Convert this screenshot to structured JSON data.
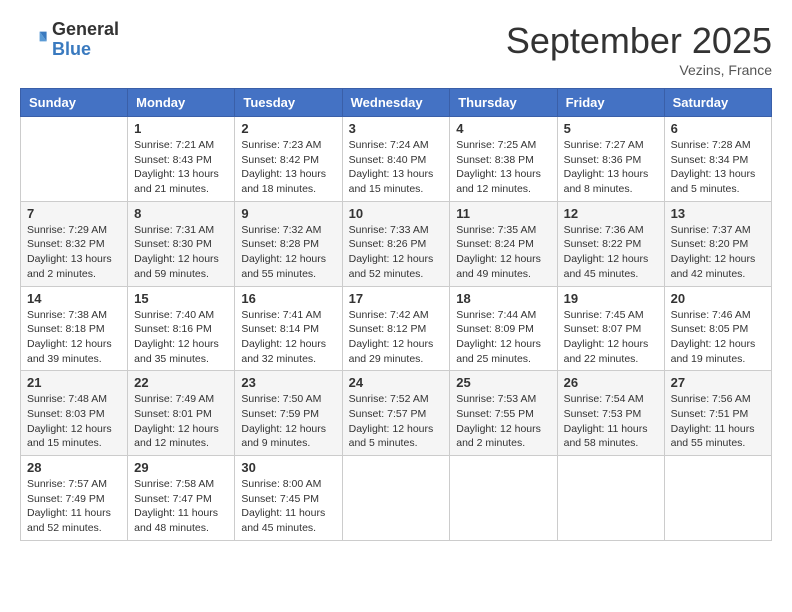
{
  "logo": {
    "general": "General",
    "blue": "Blue"
  },
  "header": {
    "month": "September 2025",
    "location": "Vezins, France"
  },
  "weekdays": [
    "Sunday",
    "Monday",
    "Tuesday",
    "Wednesday",
    "Thursday",
    "Friday",
    "Saturday"
  ],
  "weeks": [
    [
      {
        "day": "",
        "info": ""
      },
      {
        "day": "1",
        "info": "Sunrise: 7:21 AM\nSunset: 8:43 PM\nDaylight: 13 hours\nand 21 minutes."
      },
      {
        "day": "2",
        "info": "Sunrise: 7:23 AM\nSunset: 8:42 PM\nDaylight: 13 hours\nand 18 minutes."
      },
      {
        "day": "3",
        "info": "Sunrise: 7:24 AM\nSunset: 8:40 PM\nDaylight: 13 hours\nand 15 minutes."
      },
      {
        "day": "4",
        "info": "Sunrise: 7:25 AM\nSunset: 8:38 PM\nDaylight: 13 hours\nand 12 minutes."
      },
      {
        "day": "5",
        "info": "Sunrise: 7:27 AM\nSunset: 8:36 PM\nDaylight: 13 hours\nand 8 minutes."
      },
      {
        "day": "6",
        "info": "Sunrise: 7:28 AM\nSunset: 8:34 PM\nDaylight: 13 hours\nand 5 minutes."
      }
    ],
    [
      {
        "day": "7",
        "info": "Sunrise: 7:29 AM\nSunset: 8:32 PM\nDaylight: 13 hours\nand 2 minutes."
      },
      {
        "day": "8",
        "info": "Sunrise: 7:31 AM\nSunset: 8:30 PM\nDaylight: 12 hours\nand 59 minutes."
      },
      {
        "day": "9",
        "info": "Sunrise: 7:32 AM\nSunset: 8:28 PM\nDaylight: 12 hours\nand 55 minutes."
      },
      {
        "day": "10",
        "info": "Sunrise: 7:33 AM\nSunset: 8:26 PM\nDaylight: 12 hours\nand 52 minutes."
      },
      {
        "day": "11",
        "info": "Sunrise: 7:35 AM\nSunset: 8:24 PM\nDaylight: 12 hours\nand 49 minutes."
      },
      {
        "day": "12",
        "info": "Sunrise: 7:36 AM\nSunset: 8:22 PM\nDaylight: 12 hours\nand 45 minutes."
      },
      {
        "day": "13",
        "info": "Sunrise: 7:37 AM\nSunset: 8:20 PM\nDaylight: 12 hours\nand 42 minutes."
      }
    ],
    [
      {
        "day": "14",
        "info": "Sunrise: 7:38 AM\nSunset: 8:18 PM\nDaylight: 12 hours\nand 39 minutes."
      },
      {
        "day": "15",
        "info": "Sunrise: 7:40 AM\nSunset: 8:16 PM\nDaylight: 12 hours\nand 35 minutes."
      },
      {
        "day": "16",
        "info": "Sunrise: 7:41 AM\nSunset: 8:14 PM\nDaylight: 12 hours\nand 32 minutes."
      },
      {
        "day": "17",
        "info": "Sunrise: 7:42 AM\nSunset: 8:12 PM\nDaylight: 12 hours\nand 29 minutes."
      },
      {
        "day": "18",
        "info": "Sunrise: 7:44 AM\nSunset: 8:09 PM\nDaylight: 12 hours\nand 25 minutes."
      },
      {
        "day": "19",
        "info": "Sunrise: 7:45 AM\nSunset: 8:07 PM\nDaylight: 12 hours\nand 22 minutes."
      },
      {
        "day": "20",
        "info": "Sunrise: 7:46 AM\nSunset: 8:05 PM\nDaylight: 12 hours\nand 19 minutes."
      }
    ],
    [
      {
        "day": "21",
        "info": "Sunrise: 7:48 AM\nSunset: 8:03 PM\nDaylight: 12 hours\nand 15 minutes."
      },
      {
        "day": "22",
        "info": "Sunrise: 7:49 AM\nSunset: 8:01 PM\nDaylight: 12 hours\nand 12 minutes."
      },
      {
        "day": "23",
        "info": "Sunrise: 7:50 AM\nSunset: 7:59 PM\nDaylight: 12 hours\nand 9 minutes."
      },
      {
        "day": "24",
        "info": "Sunrise: 7:52 AM\nSunset: 7:57 PM\nDaylight: 12 hours\nand 5 minutes."
      },
      {
        "day": "25",
        "info": "Sunrise: 7:53 AM\nSunset: 7:55 PM\nDaylight: 12 hours\nand 2 minutes."
      },
      {
        "day": "26",
        "info": "Sunrise: 7:54 AM\nSunset: 7:53 PM\nDaylight: 11 hours\nand 58 minutes."
      },
      {
        "day": "27",
        "info": "Sunrise: 7:56 AM\nSunset: 7:51 PM\nDaylight: 11 hours\nand 55 minutes."
      }
    ],
    [
      {
        "day": "28",
        "info": "Sunrise: 7:57 AM\nSunset: 7:49 PM\nDaylight: 11 hours\nand 52 minutes."
      },
      {
        "day": "29",
        "info": "Sunrise: 7:58 AM\nSunset: 7:47 PM\nDaylight: 11 hours\nand 48 minutes."
      },
      {
        "day": "30",
        "info": "Sunrise: 8:00 AM\nSunset: 7:45 PM\nDaylight: 11 hours\nand 45 minutes."
      },
      {
        "day": "",
        "info": ""
      },
      {
        "day": "",
        "info": ""
      },
      {
        "day": "",
        "info": ""
      },
      {
        "day": "",
        "info": ""
      }
    ]
  ]
}
